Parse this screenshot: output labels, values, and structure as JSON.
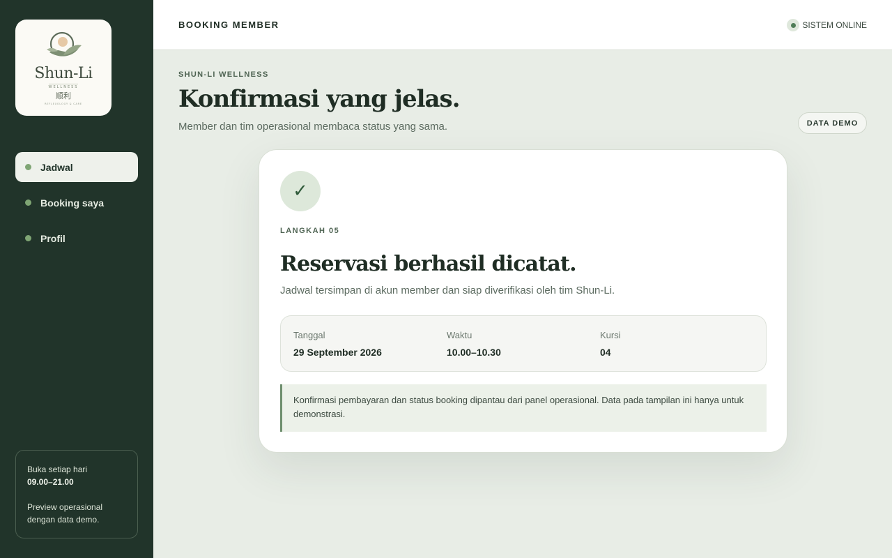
{
  "sidebar": {
    "logo": {
      "name": "Shun-Li",
      "subtitle": "WELLNESS",
      "cjk": "顺利",
      "tagline": "REFLEXOLOGY & CARE"
    },
    "items": [
      {
        "label": "Jadwal",
        "active": true
      },
      {
        "label": "Booking saya",
        "active": false
      },
      {
        "label": "Profil",
        "active": false
      }
    ],
    "hours": {
      "line1": "Buka setiap hari",
      "time": "09.00–21.00",
      "note_line1": "Preview operasional",
      "note_line2": "dengan data demo."
    }
  },
  "topbar": {
    "title": "BOOKING MEMBER",
    "status": "SISTEM ONLINE"
  },
  "header": {
    "eyebrow": "SHUN-LI WELLNESS",
    "title": "Konfirmasi yang jelas.",
    "subtitle": "Member dan tim operasional membaca status yang sama.",
    "badge": "DATA DEMO"
  },
  "card": {
    "icon": "check-icon",
    "check_glyph": "✓",
    "step": "LANGKAH 05",
    "title": "Reservasi berhasil dicatat.",
    "subtitle": "Jadwal tersimpan di akun member dan siap diverifikasi oleh tim Shun-Li.",
    "details": [
      {
        "label": "Tanggal",
        "value": "29 September 2026"
      },
      {
        "label": "Waktu",
        "value": "10.00–10.30"
      },
      {
        "label": "Kursi",
        "value": "04"
      }
    ],
    "note": "Konfirmasi pembayaran dan status booking dipantau dari panel operasional. Data pada tampilan ini hanya untuk demonstrasi."
  },
  "colors": {
    "sidebar_bg": "#21342a",
    "page_bg": "#e8ede6",
    "accent": "#7fa574",
    "status_dot": "#4f7d57"
  }
}
